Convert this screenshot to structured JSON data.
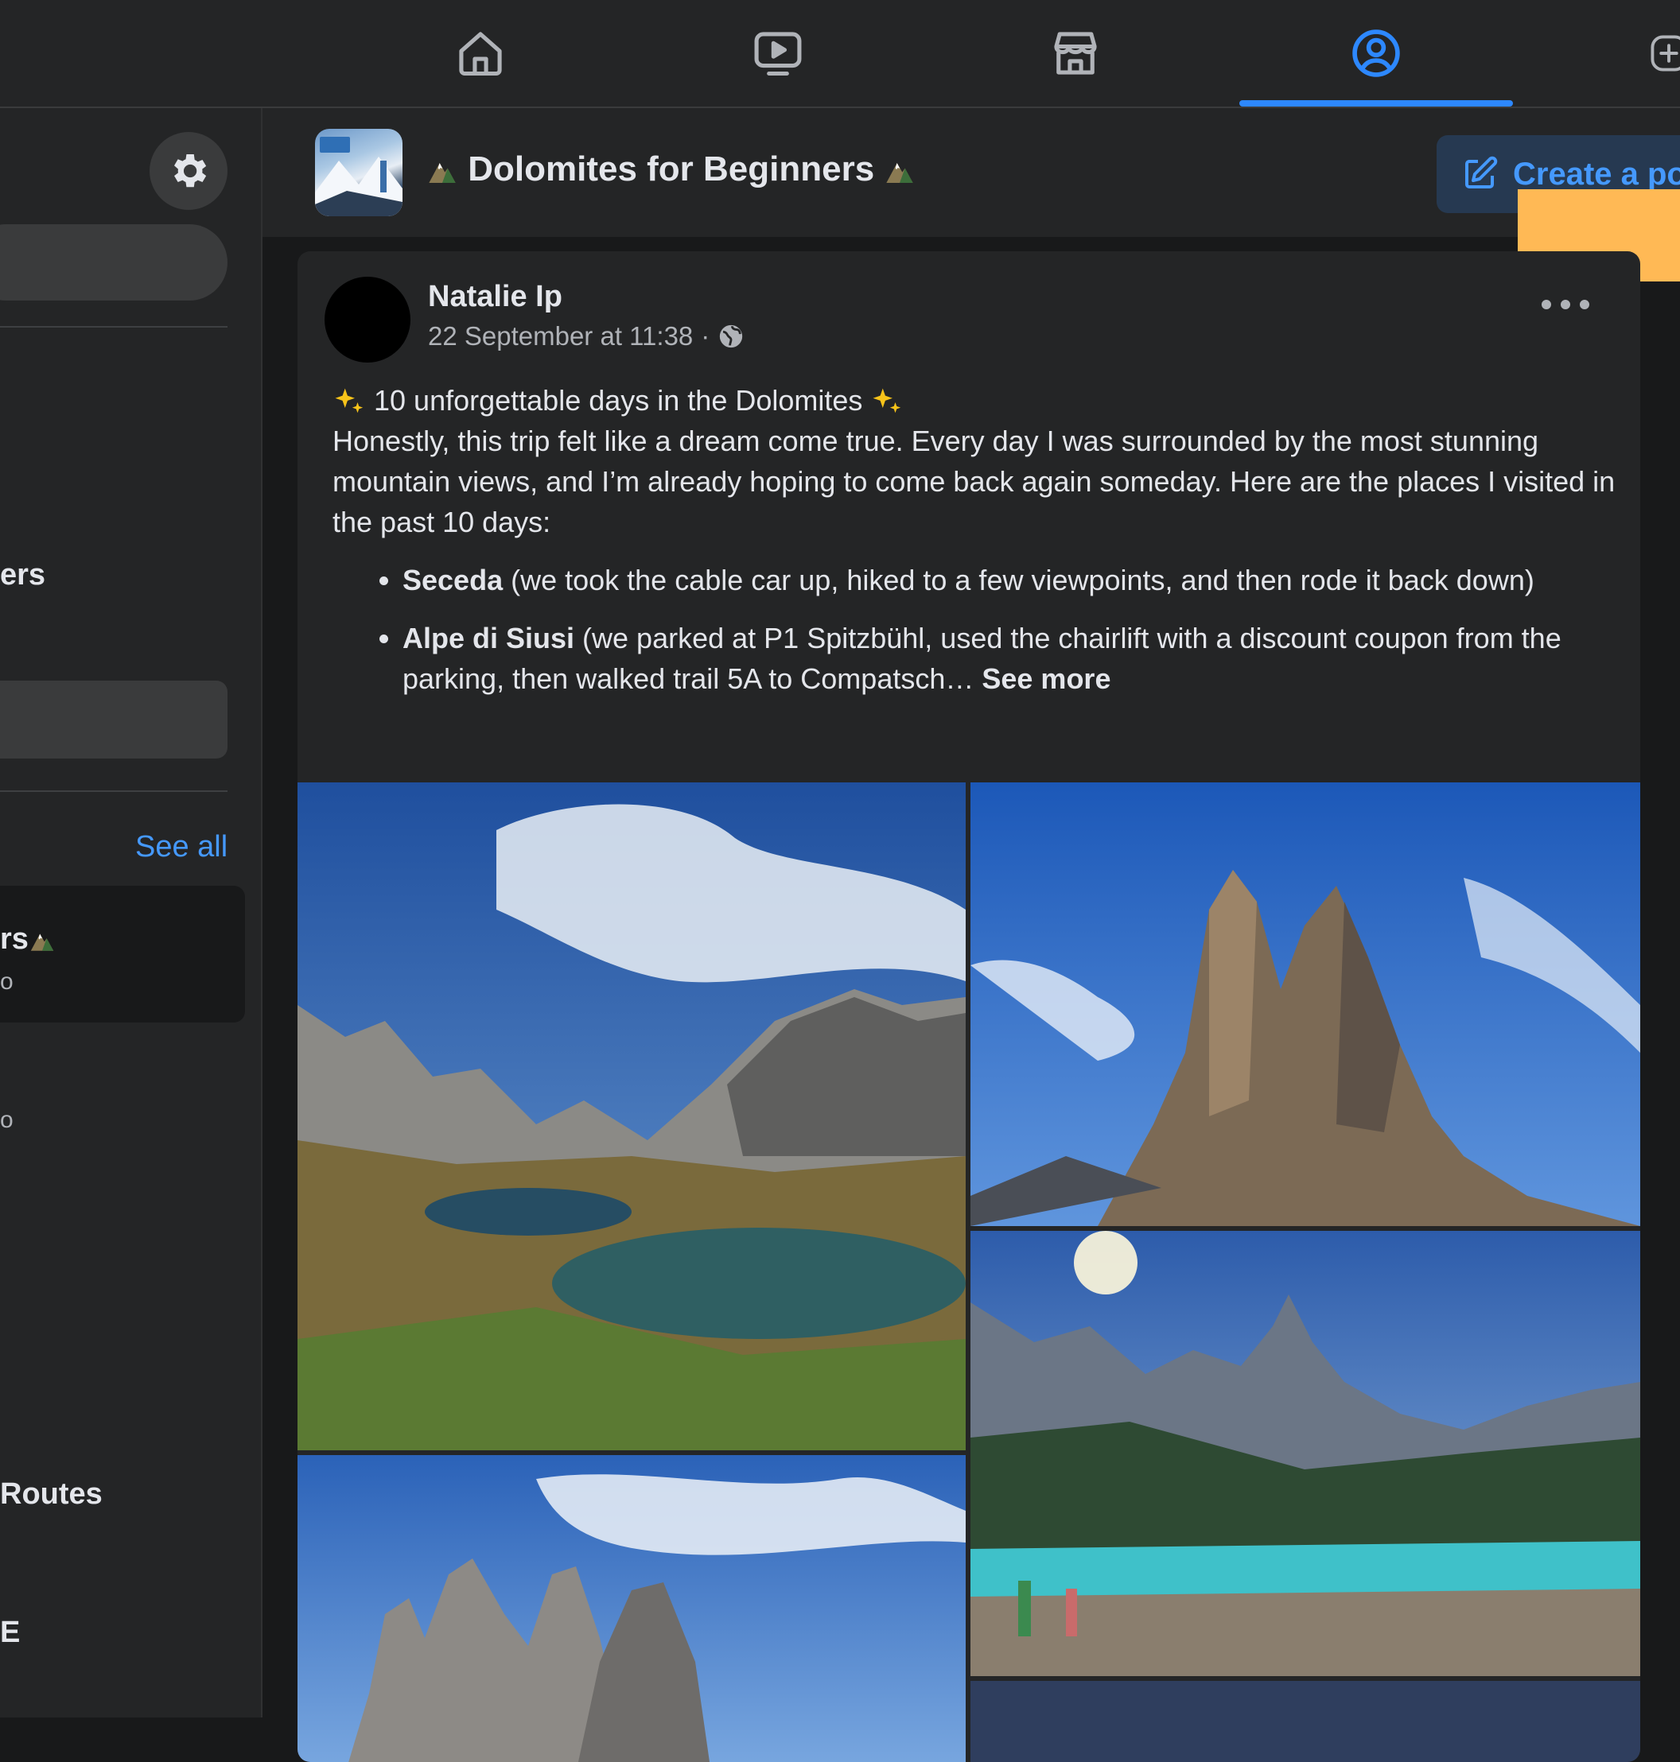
{
  "topnav": {
    "tabs": [
      {
        "name": "home-icon"
      },
      {
        "name": "watch-icon"
      },
      {
        "name": "marketplace-icon"
      },
      {
        "name": "groups-icon",
        "active": true
      },
      {
        "name": "add-icon"
      }
    ],
    "accent_color": "#2d88ff"
  },
  "sidebar": {
    "item_partial_1": "ers",
    "see_all": "See all",
    "active_group_partial": "rs",
    "active_group_sub": "o",
    "group_sub_2": "o",
    "item_routes": "Routes",
    "item_e": "E"
  },
  "group": {
    "title": "Dolomites for Beginners",
    "create_post_label": "Create a po"
  },
  "post": {
    "author": "Natalie Ip",
    "timestamp": "22 September at 11:38",
    "separator": "·",
    "intro": "10 unforgettable days in the Dolomites",
    "paragraph": "Honestly, this trip felt like a dream come true. Every day I was surrounded by the most stunning mountain views, and I’m already hoping to come back again someday. Here are the places I visited in the past 10 days:",
    "bullets": [
      {
        "place": "Seceda",
        "text": " (we took the cable car up, hiked to a few viewpoints, and then rode it back down)"
      },
      {
        "place": "Alpe di Siusi",
        "text": " (we parked at P1 Spitzbühl, used the chairlift with a discount coupon from the parking, then walked trail 5A to Compatsch… "
      }
    ],
    "see_more": "See more"
  }
}
